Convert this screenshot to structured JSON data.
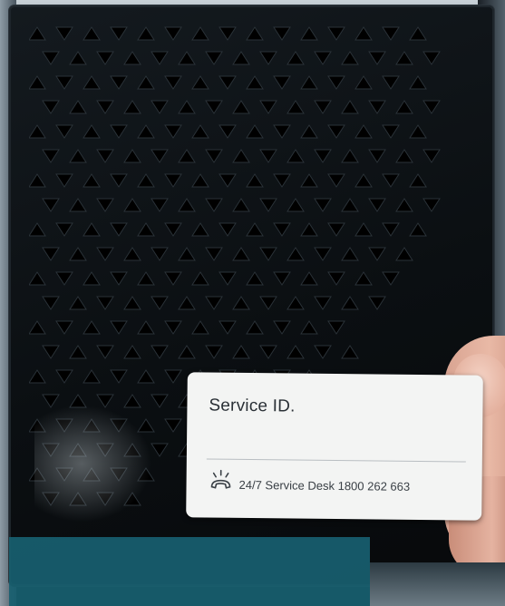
{
  "photo": {
    "subject": "service-box-with-label",
    "label": {
      "title": "Service ID.",
      "service_desk": "24/7 Service Desk 1800 262 663",
      "icon": "phone-ringing-icon"
    },
    "colors": {
      "device": "#0b0f12",
      "label_bg": "#f3f4f3",
      "label_text": "#2a3036",
      "overlay": "#186070"
    }
  }
}
